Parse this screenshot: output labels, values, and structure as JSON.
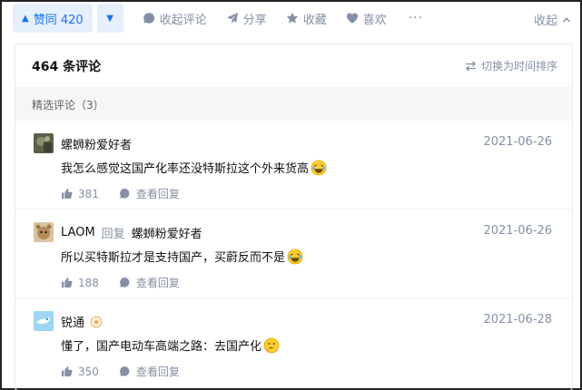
{
  "action_bar": {
    "upvote_label": "赞同 420",
    "comment_label": "收起评论",
    "share_label": "分享",
    "favorite_label": "收藏",
    "like_label": "喜欢",
    "more_label": "···",
    "collapse_label": "收起"
  },
  "comments": {
    "title": "464 条评论",
    "sort_label": "切换为时间排序",
    "section_label": "精选评论（3）",
    "items": [
      {
        "author": "螺蛳粉爱好者",
        "reply_word": "",
        "reply_to": "",
        "date": "2021-06-26",
        "content": "我怎么感觉这国产化率还没特斯拉这个外来货高",
        "emoji": "laugh-cry-icon",
        "likes": "381",
        "view_replies": "查看回复"
      },
      {
        "author": "LAOM",
        "reply_word": "回复",
        "reply_to": "螺蛳粉爱好者",
        "date": "2021-06-26",
        "content": "所以买特斯拉才是支持国产，买蔚反而不是",
        "emoji": "laugh-cry-icon",
        "likes": "188",
        "view_replies": "查看回复"
      },
      {
        "author": "锐通",
        "reply_word": "",
        "reply_to": "",
        "date": "2021-06-28",
        "content": "懂了，国产电动车高端之路：去国产化",
        "emoji": "thinking-icon",
        "likes": "350",
        "view_replies": "查看回复"
      }
    ]
  },
  "colors": {
    "accent": "#1772f6",
    "accent_bg": "#e6f0fd",
    "muted": "#8590a6",
    "section_bg": "#f6f6f6"
  }
}
